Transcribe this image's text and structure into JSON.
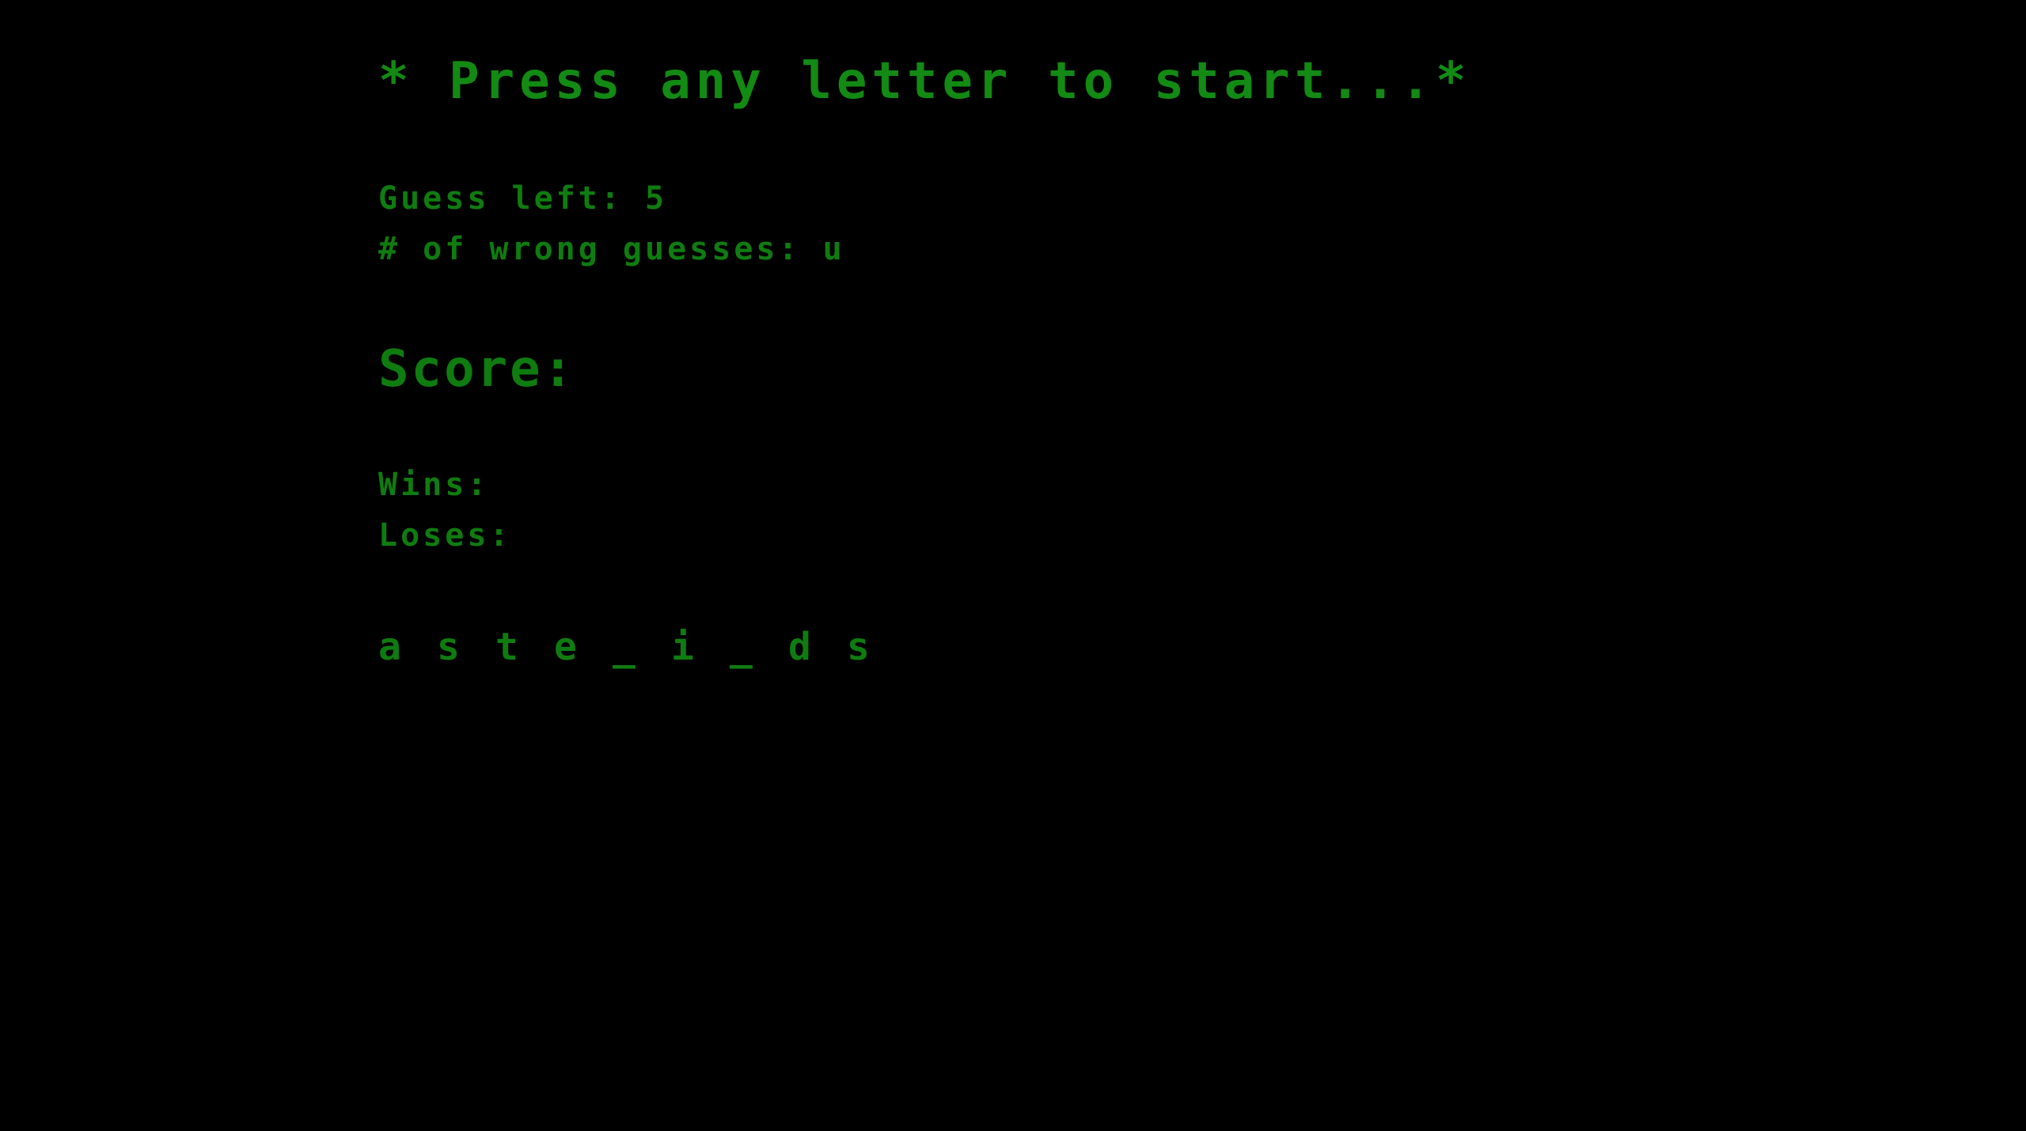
{
  "game": {
    "prompt": "* Press any letter to start...*",
    "guesses_left_label": "Guess left:",
    "guesses_left_value": "5",
    "wrong_guesses_label": "# of wrong guesses:",
    "wrong_guesses_value": "u",
    "score_title": "Score:",
    "wins_label": "Wins:",
    "wins_value": "",
    "loses_label": "Loses:",
    "loses_value": "",
    "word_letters": [
      "a",
      "s",
      "t",
      "e",
      "_",
      "i",
      "_",
      "d",
      "s"
    ]
  },
  "colors": {
    "background": "#000000",
    "text": "#0f7c10"
  }
}
